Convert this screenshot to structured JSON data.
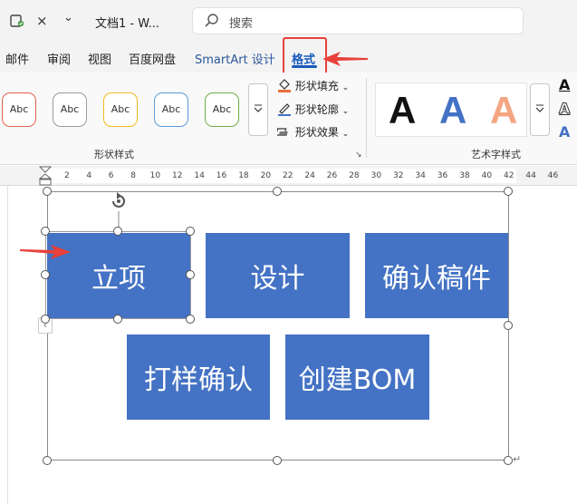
{
  "titlebar": {
    "doc_title": "文档1 - W...",
    "close_glyph": "×",
    "customize_glyph": "⌄"
  },
  "search": {
    "placeholder": "搜索"
  },
  "tabs": [
    {
      "label": "邮件"
    },
    {
      "label": "审阅"
    },
    {
      "label": "视图"
    },
    {
      "label": "百度网盘"
    },
    {
      "label": "SmartArt 设计"
    },
    {
      "label": "格式"
    }
  ],
  "ribbon": {
    "shape_styles": [
      {
        "label": "Abc",
        "color": "#e0644a"
      },
      {
        "label": "Abc",
        "color": "#9a9a9a"
      },
      {
        "label": "Abc",
        "color": "#f2b81f"
      },
      {
        "label": "Abc",
        "color": "#5b9bd5"
      },
      {
        "label": "Abc",
        "color": "#70ad47"
      }
    ],
    "commands": {
      "fill": "形状填充",
      "outline": "形状轮廓",
      "effects": "形状效果"
    },
    "group_shape_styles": "形状样式",
    "group_wordart_styles": "艺术字样式",
    "wordart_letter": "A",
    "wordart_colors": [
      "#111111",
      "#4472c4",
      "#f4a582"
    ]
  },
  "ruler": {
    "ticks": [
      "2",
      "4",
      "6",
      "8",
      "10",
      "12",
      "14",
      "16",
      "18",
      "20",
      "22",
      "24",
      "26",
      "28",
      "30",
      "32",
      "34",
      "36",
      "38",
      "40",
      "42",
      "44",
      "46"
    ]
  },
  "smartart": {
    "nodes": [
      {
        "text": "立项"
      },
      {
        "text": "设计"
      },
      {
        "text": "确认稿件"
      },
      {
        "text": "打样确认"
      },
      {
        "text": "创建BOM"
      }
    ],
    "node_color": "#4472c4"
  },
  "doc": {
    "collapse_glyph": "‹",
    "paragraph_mark": "↵"
  },
  "accent": "#e8403a"
}
